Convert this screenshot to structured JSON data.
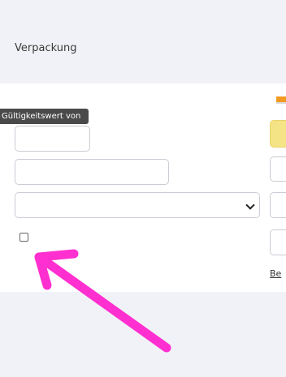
{
  "section": {
    "title": "Verpackung"
  },
  "tooltip": {
    "text": "Gültigkeitswert von"
  },
  "right_column": {
    "link_text": "Be"
  },
  "colors": {
    "arrow": "#ff2fd0",
    "panel": "#ffffff",
    "background": "#f1f2f7",
    "highlight_field": "#f5e485"
  },
  "icons": {
    "top_right": "flag-icon",
    "select": "chevron-down-icon",
    "annotation": "arrow-annotation"
  }
}
